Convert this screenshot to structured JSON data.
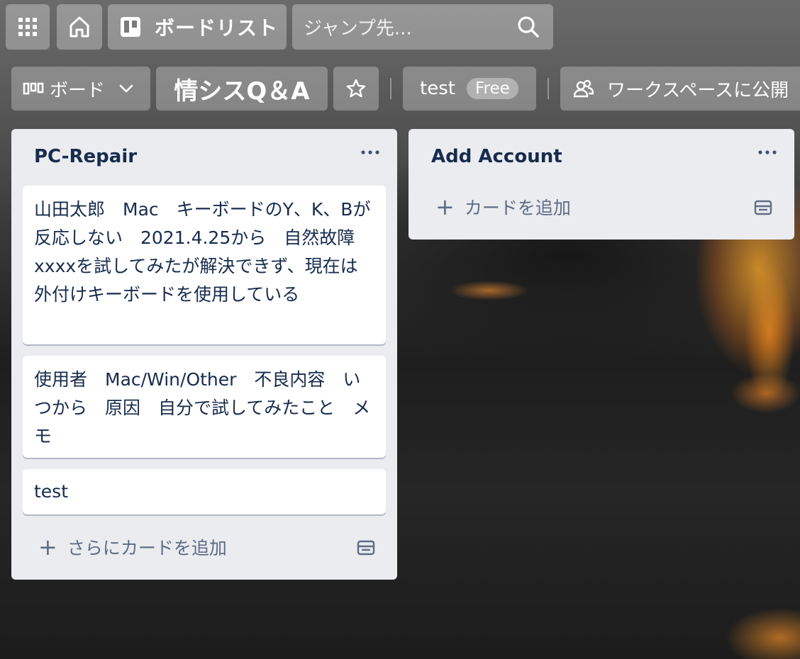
{
  "topbar": {
    "apps_icon": "grid-icon",
    "home_icon": "home-icon",
    "boardlist_label": "ボードリスト",
    "jump_placeholder": "ジャンプ先...",
    "search_icon": "search-icon"
  },
  "boardbar": {
    "view_label": "ボード",
    "board_title": "情シスQ＆A",
    "workspace_name": "test",
    "workspace_badge": "Free",
    "visibility_label": "ワークスペースに公開"
  },
  "lists": [
    {
      "title": "PC-Repair",
      "cards": [
        "山田太郎　Mac　キーボードのY、K、Bが反応しない　2021.4.25から　自然故障　xxxxを試してみたが解決できず、現在は外付けキーボードを使用している",
        "使用者　Mac/Win/Other　不良内容　いつから　原因　自分で試してみたこと　メモ",
        "test"
      ],
      "add_label": "さらにカードを追加"
    },
    {
      "title": "Add Account",
      "cards": [],
      "add_label": "カードを追加"
    }
  ],
  "colors": {
    "list_bg": "#ebecf0",
    "text": "#172b4d",
    "muted": "#5e6c84"
  }
}
